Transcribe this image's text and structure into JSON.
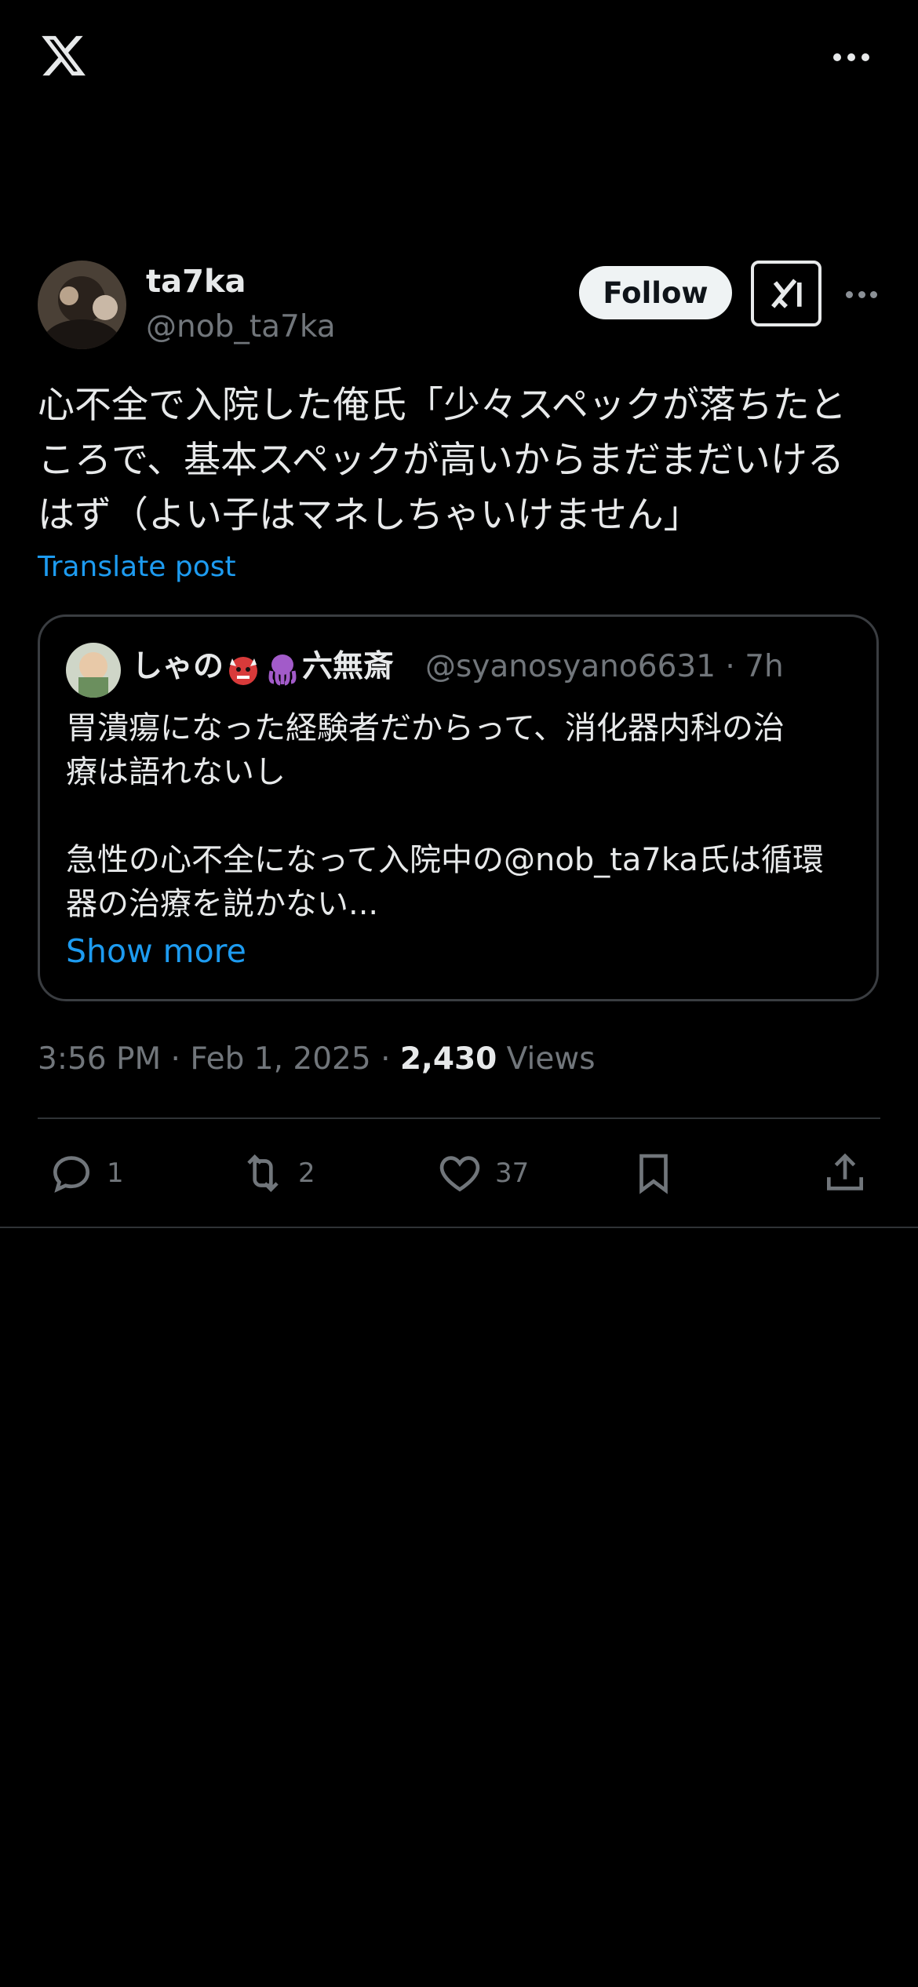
{
  "header": {
    "logo": "x-logo-icon",
    "menu": "more-icon"
  },
  "post": {
    "author_name": "ta7ka",
    "author_handle": "@nob_ta7ka",
    "follow_label": "Follow",
    "text": "心不全で入院した俺氏「少々スペックが落ちたと\nころで、基本スペックが高いからまだまだいける\nはず（よい子はマネしちゃいけません」",
    "translate_label": "Translate post",
    "time": "3:56 PM",
    "date": "Feb 1, 2025",
    "views_count": "2,430",
    "views_label": "Views"
  },
  "quote": {
    "name_part1": "しゃの",
    "name_part2": "六無斎",
    "handle_time": "@syanosyano6631 · 7h",
    "text": "胃潰瘍になった経験者だからって、消化器内科の治\n療は語れないし\n\n急性の心不全になって入院中の@nob_ta7ka氏は循環\n器の治療を説かない...",
    "show_more": "Show more"
  },
  "actions": {
    "replies": "1",
    "reposts": "2",
    "likes": "37"
  },
  "colors": {
    "background": "#000000",
    "accent": "#1d9bf0",
    "muted": "#71767b"
  }
}
